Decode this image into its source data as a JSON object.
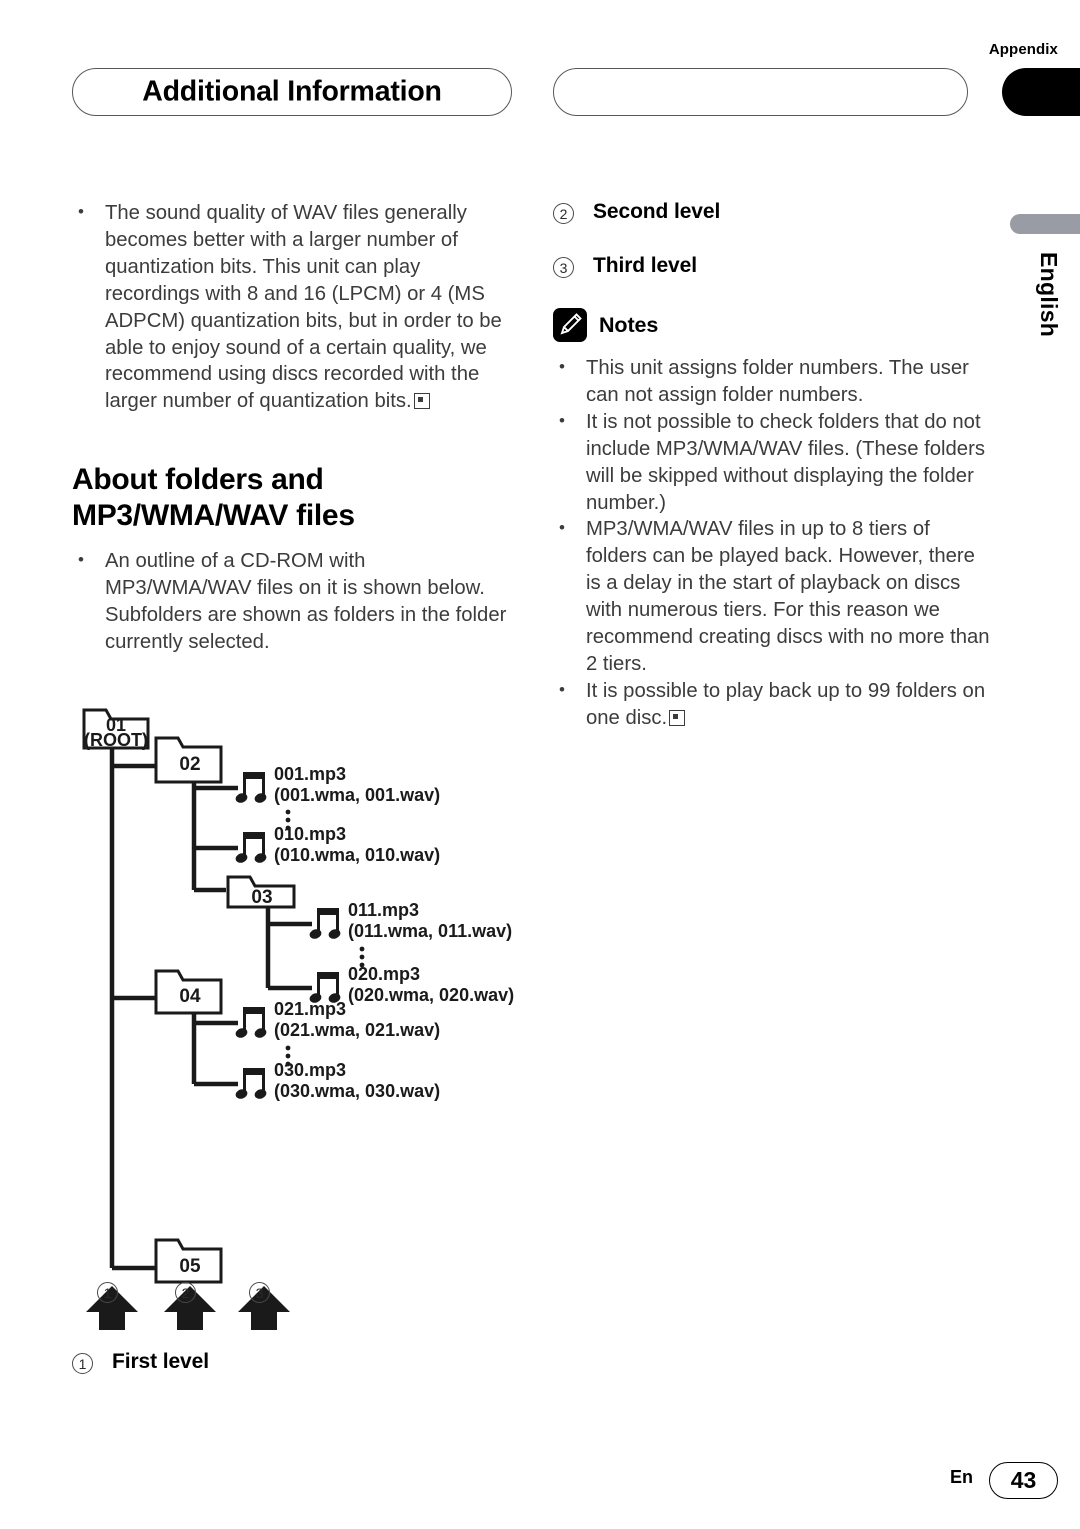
{
  "header": {
    "appendix_label": "Appendix",
    "title": "Additional Information",
    "blank_pill": ""
  },
  "side_tab": {
    "language": "English"
  },
  "left_column": {
    "intro_bullets": [
      "The sound quality of WAV files generally becomes better with a larger number of quantization bits. This unit can play recordings with 8 and 16 (LPCM) or 4 (MS ADPCM) quantization bits, but in order to be able to enjoy sound of a certain quality, we recommend using discs recorded with the larger number of quantization bits."
    ],
    "section_heading": "About folders and MP3/WMA/WAV files",
    "section_bullets": [
      "An outline of a CD-ROM with MP3/WMA/WAV files on it is shown below. Subfolders are shown as folders in the folder currently selected."
    ],
    "first_level": {
      "number": "1",
      "label": "First level"
    }
  },
  "right_column": {
    "levels": [
      {
        "number": "2",
        "label": "Second level"
      },
      {
        "number": "3",
        "label": "Third level"
      }
    ],
    "notes_title": "Notes",
    "notes_icon": "pencil-icon",
    "notes_bullets": [
      "This unit assigns folder numbers. The user can not assign folder numbers.",
      "It is not possible to check folders that do not include MP3/WMA/WAV files. (These folders will be skipped without displaying the folder number.)",
      "MP3/WMA/WAV files in up to 8 tiers of folders can be played back. However, there is a delay in the start of playback on discs with numerous tiers. For this reason we recommend creating discs with no more than 2 tiers.",
      "It is possible to play back up to 99 folders on one disc."
    ]
  },
  "diagram": {
    "folders": [
      {
        "id": "f01",
        "label_line1": "01",
        "label_line2": "(ROOT)"
      },
      {
        "id": "f02",
        "label_line1": "02",
        "label_line2": ""
      },
      {
        "id": "f03",
        "label_line1": "03",
        "label_line2": ""
      },
      {
        "id": "f04",
        "label_line1": "04",
        "label_line2": ""
      },
      {
        "id": "f05",
        "label_line1": "05",
        "label_line2": ""
      }
    ],
    "files": [
      {
        "id": "file001",
        "name": "001.mp3",
        "alts": "(001.wma, 001.wav)"
      },
      {
        "id": "file010",
        "name": "010.mp3",
        "alts": "(010.wma, 010.wav)"
      },
      {
        "id": "file011",
        "name": "011.mp3",
        "alts": "(011.wma, 011.wav)"
      },
      {
        "id": "file020",
        "name": "020.mp3",
        "alts": "(020.wma, 020.wav)"
      },
      {
        "id": "file021",
        "name": "021.mp3",
        "alts": "(021.wma, 021.wav)"
      },
      {
        "id": "file030",
        "name": "030.mp3",
        "alts": "(030.wma, 030.wav)"
      }
    ],
    "arrow_markers": [
      {
        "id": "m1",
        "number": "1"
      },
      {
        "id": "m2",
        "number": "2"
      },
      {
        "id": "m3",
        "number": "3"
      }
    ]
  },
  "footer": {
    "language_code": "En",
    "page_number": "43"
  }
}
